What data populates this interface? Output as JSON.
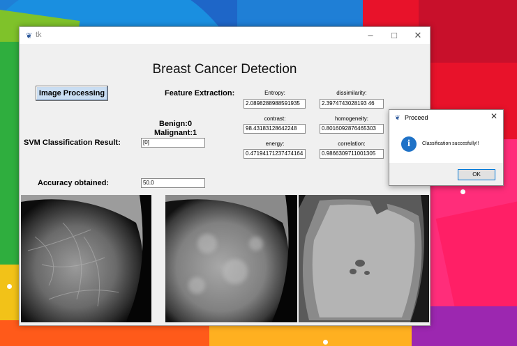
{
  "window": {
    "title": "tk",
    "heading": "Breast Cancer Detection"
  },
  "controls": {
    "image_processing_button": "Image Processing",
    "feature_extraction_label": "Feature Extraction:",
    "svm_label": "SVM Classification  Result:",
    "benign_label": "Benign:0",
    "malignant_label": "Malignant:1",
    "svm_result": "[0]",
    "accuracy_label": "Accuracy obtained:",
    "accuracy_value": "50.0"
  },
  "features": {
    "entropy": {
      "label": "Entropy:",
      "value": "2.0898288988591935"
    },
    "dissimilarity": {
      "label": "dissimilarity:",
      "value": "2.3974743028193 46"
    },
    "contrast": {
      "label": "contrast:",
      "value": "98.43183128642248"
    },
    "homogeneity": {
      "label": "homogeneity:",
      "value": "0.8016092876465303"
    },
    "energy": {
      "label": "energy:",
      "value": "0.47194171237474164"
    },
    "correlation": {
      "label": "correlation:",
      "value": "0.9866309711001305"
    }
  },
  "dialog": {
    "title": "Proceed",
    "message": "Classification succesfully!!",
    "ok_label": "OK"
  },
  "colors": {
    "button_face": "#c9ddf2",
    "info_icon": "#1f72c7",
    "focus_border": "#0078d7"
  }
}
